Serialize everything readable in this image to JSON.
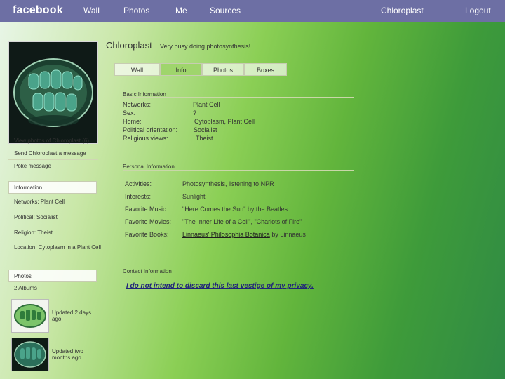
{
  "topbar": {
    "logo": "facebook",
    "items": [
      "Wall",
      "Photos",
      "Me",
      "Sources",
      "Chloroplast",
      "Logout"
    ]
  },
  "profile": {
    "name": "Chloroplast",
    "status": "Very busy doing photosynthesis!",
    "photo_caption": "View photos of Chloroplast (6)",
    "send_message": "Send Chloroplast a message",
    "poke_message": "Poke message"
  },
  "tabs": [
    "Wall",
    "Info",
    "Photos",
    "Boxes"
  ],
  "left_info": {
    "section_title": "Information",
    "networks": "Networks: Plant Cell",
    "political": "Political: Socialist",
    "religion": "Religion: Theist",
    "location": "Location: Cytoplasm in a Plant Cell"
  },
  "photos": {
    "section_title": "Photos",
    "albums_count": "2 Albums",
    "album1_updated": "Updated 2 days ago",
    "album2_updated": "Updated two months ago"
  },
  "basic_info": {
    "title": "Basic Information",
    "rows": [
      {
        "label": "Networks:",
        "value": "Plant Cell"
      },
      {
        "label": "Sex:",
        "value": "?"
      },
      {
        "label": "Home:",
        "value": "Cytoplasm, Plant Cell"
      },
      {
        "label": "Political orientation:",
        "value": "Socialist"
      },
      {
        "label": "Religious views:",
        "value": "Theist"
      }
    ]
  },
  "personal_info": {
    "title": "Personal Information",
    "rows": [
      {
        "label": "Activities:",
        "value": "Photosynthesis, listening to NPR"
      },
      {
        "label": "Interests:",
        "value": "Sunlight"
      },
      {
        "label": "Favorite Music:",
        "value": "\"Here Comes the Sun\" by the Beatles"
      },
      {
        "label": "Favorite Movies:",
        "value": "\"The Inner Life of a Cell\", \"Chariots of Fire\""
      },
      {
        "label": "Favorite Books:",
        "value_link": "Linnaeus' Philosophia Botanica",
        "value_suffix": " by Linnaeus"
      }
    ]
  },
  "contact_info": {
    "title": "Contact Information",
    "privacy_text": "I do not intend to discard this last vestige of my privacy."
  }
}
